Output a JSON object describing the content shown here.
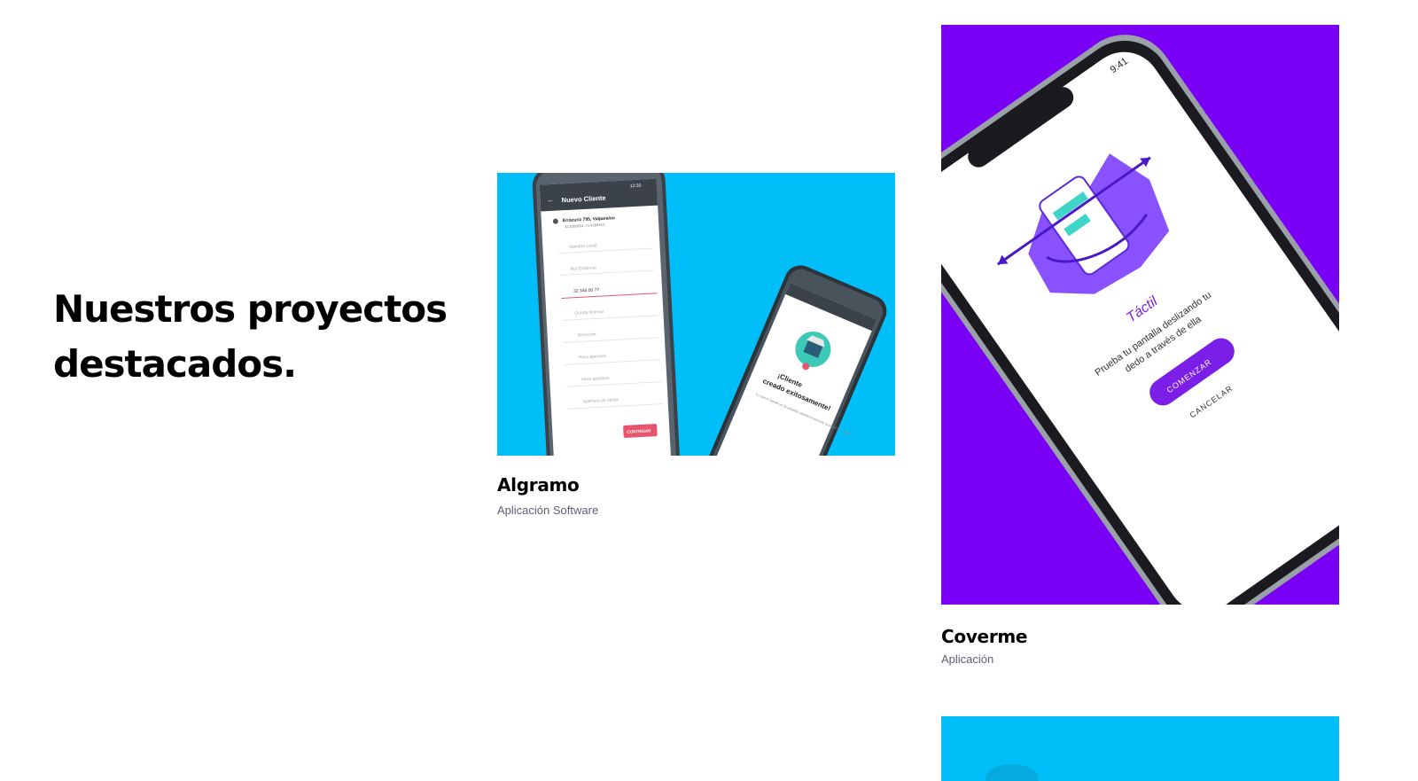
{
  "page": {
    "heading": "Nuestros proyectos\ndestacados."
  },
  "colors": {
    "algramo_bg": "#00bff8",
    "coverme_bg": "#7a00f5",
    "third_bg": "#00bff8",
    "coverme_accent": "#7b1fe8"
  },
  "projects": [
    {
      "title": "Algramo",
      "subtitle": "Aplicación Software",
      "screen": {
        "time": "12:30",
        "header": "Nuevo Cliente",
        "address_line1": "Errázuriz 795, Valparaíso",
        "address_line2": "33.0389634,-71.6289943",
        "fields": [
          "Nombre Local",
          "Rut Empresa",
          "32 346 00 77",
          "Quínta Normal",
          "Dirección",
          "Hora apertura",
          "Hora apertura",
          "Apertura de venta"
        ],
        "button": "CONTINUAR",
        "success_title_1": "¡Cliente",
        "success_title_2": "creado exitosamente!",
        "success_body": "Tu nuevo cliente se ha añadido satisfactoriamente al panel de clientes"
      }
    },
    {
      "title": "Coverme",
      "subtitle": "Aplicación",
      "screen": {
        "time": "9:41",
        "close": "×",
        "title": "Táctil",
        "body_line1": "Prueba tu pantalla deslizando tu",
        "body_line2": "dedo a través de ella",
        "button": "COMENZAR",
        "cancel": "CANCELAR"
      }
    }
  ]
}
